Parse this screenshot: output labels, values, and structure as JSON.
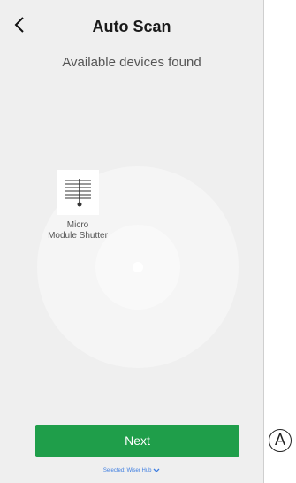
{
  "header": {
    "back_icon": "chevron-left-icon",
    "title": "Auto Scan"
  },
  "subtitle": "Available devices found",
  "device": {
    "icon": "shutter-icon",
    "label_line1": "Micro",
    "label_line2": "Module Shutter"
  },
  "next_button": {
    "label": "Next",
    "color": "#1f9e4a"
  },
  "selected_hub": {
    "label": "Selected: Wiser Hub",
    "icon": "chevron-down-icon",
    "color": "#3d7de0"
  },
  "callout": {
    "label": "A"
  }
}
